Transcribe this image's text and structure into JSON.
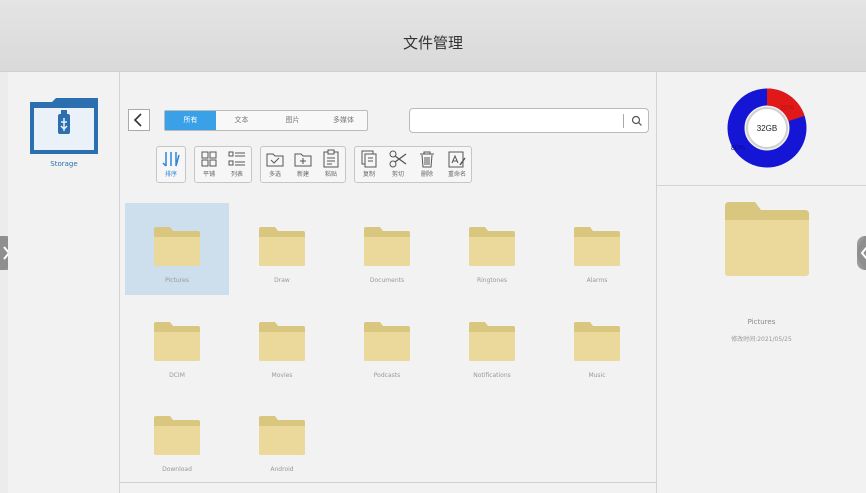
{
  "header": {
    "title": "文件管理"
  },
  "sidebar": {
    "storage_label": "Storage"
  },
  "tabs": [
    "所有",
    "文本",
    "图片",
    "多媒体"
  ],
  "toolbar": {
    "sort": "排序",
    "tile": "平铺",
    "list": "列表",
    "multi_select": "多选",
    "new": "新建",
    "paste": "粘贴",
    "copy": "复制",
    "cut": "剪切",
    "delete": "删除",
    "rename": "重命名"
  },
  "folders": [
    "Pictures",
    "Draw",
    "Documents",
    "Ringtones",
    "Alarms",
    "DCIM",
    "Movies",
    "Podcasts",
    "Notifications",
    "Music",
    "Download",
    "Android"
  ],
  "storage_chart": {
    "capacity": "32GB",
    "used_percent_label": "20%",
    "free_percent_label": "80%",
    "used_fraction": 0.2,
    "used_color": "#e01818",
    "free_color": "#1515d6"
  },
  "detail": {
    "name": "Pictures",
    "modified": "修改时间:2021/05/25"
  },
  "colors": {
    "accent": "#3aa0e8",
    "folder": "#e8d79a",
    "selected_bg": "#cddeed"
  }
}
